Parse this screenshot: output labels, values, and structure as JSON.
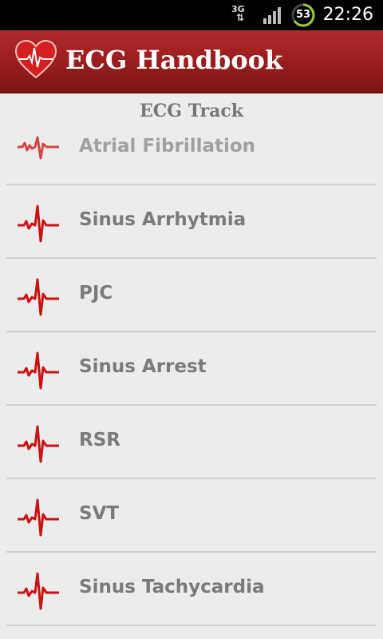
{
  "status_bar": {
    "network": "3G",
    "battery_level": "53",
    "time": "22:26"
  },
  "app_bar": {
    "title": "ECG Handbook",
    "icon": "heart-ecg-icon"
  },
  "section": {
    "title": "ECG Track"
  },
  "list": {
    "items": [
      {
        "label": "Atrial Fibrillation",
        "icon": "ecg-wave-icon"
      },
      {
        "label": "Sinus Arrhytmia",
        "icon": "ecg-wave-icon"
      },
      {
        "label": "PJC",
        "icon": "ecg-wave-icon"
      },
      {
        "label": "Sinus Arrest",
        "icon": "ecg-wave-icon"
      },
      {
        "label": "RSR",
        "icon": "ecg-wave-icon"
      },
      {
        "label": "SVT",
        "icon": "ecg-wave-icon"
      },
      {
        "label": "Sinus Tachycardia",
        "icon": "ecg-wave-icon"
      }
    ]
  },
  "colors": {
    "accent": "#9a1d1d",
    "ecg_line": "#cc1111",
    "text": "#7a7a7a"
  }
}
